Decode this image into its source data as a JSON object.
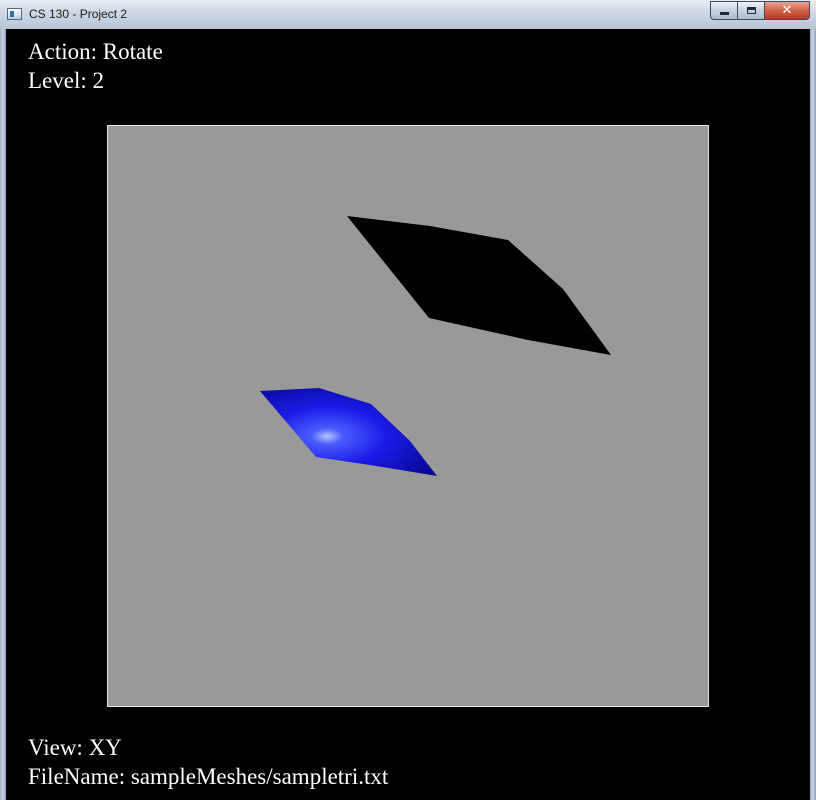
{
  "window": {
    "title": "CS 130 - Project 2",
    "buttons": {
      "minimize": "",
      "maximize": "",
      "close": "✕"
    }
  },
  "hud": {
    "action_line": "Action: Rotate",
    "level_line": "Level: 2",
    "view_line": "View: XY",
    "filename_line": "FileName: sampleMeshes/sampletri.txt"
  },
  "scene": {
    "background_color": "#999999",
    "shadow_mesh_color": "#000000",
    "lit_mesh_color": "#1a1ae6",
    "highlight_color": "#b8c6ff"
  }
}
